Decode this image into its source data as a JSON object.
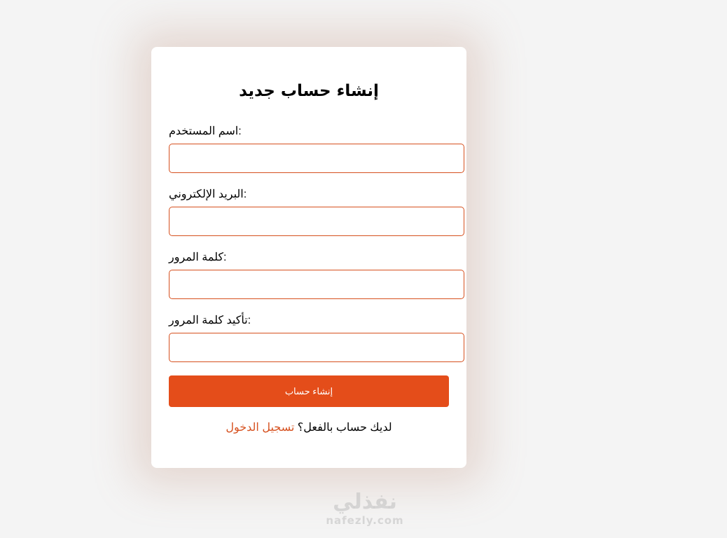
{
  "form": {
    "title": "إنشاء حساب جديد",
    "fields": [
      {
        "label": "اسم المستخدم:",
        "value": "",
        "placeholder": ""
      },
      {
        "label": "البريد الإلكتروني:",
        "value": "",
        "placeholder": ""
      },
      {
        "label": "كلمة المرور:",
        "value": "",
        "placeholder": ""
      },
      {
        "label": "تأكيد كلمة المرور:",
        "value": "",
        "placeholder": ""
      }
    ],
    "submit_label": "إنشاء حساب",
    "login_prompt": "لديك حساب بالفعل؟",
    "login_link": "تسجيل الدخول"
  },
  "watermark": {
    "logo_text": "نفذلي",
    "url": "nafezly.com"
  },
  "colors": {
    "accent": "#e44d1a",
    "input_border": "#d6501e",
    "page_background": "#f4f4f4",
    "card_background": "#ffffff"
  }
}
